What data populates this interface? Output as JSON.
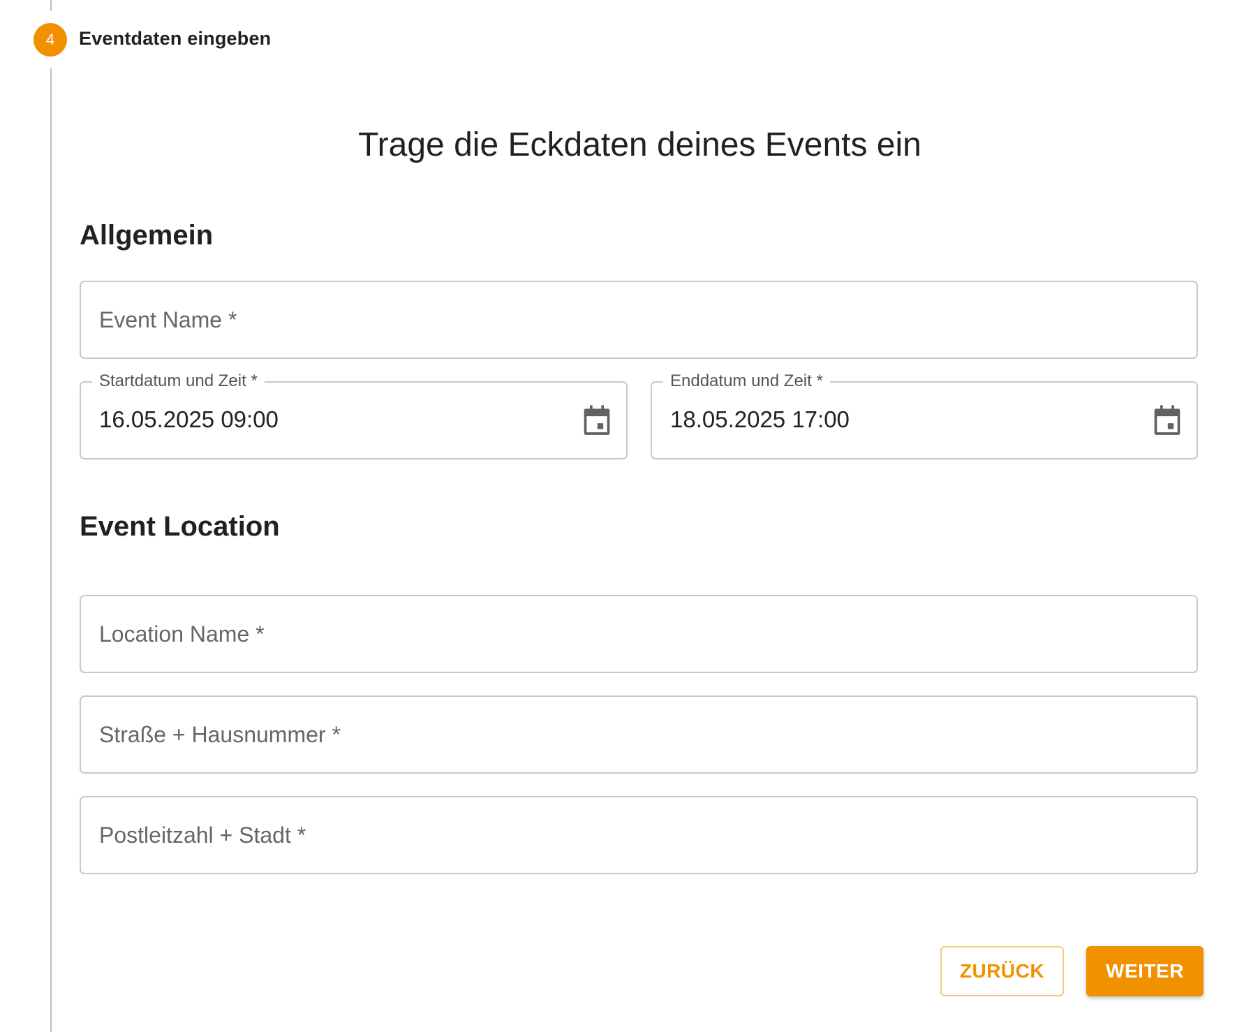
{
  "stepper": {
    "step_number": "4",
    "step_label": "Eventdaten eingeben"
  },
  "page_title": "Trage die Eckdaten deines Events ein",
  "sections": {
    "general": {
      "title": "Allgemein",
      "event_name_placeholder": "Event Name *",
      "start": {
        "label": "Startdatum und Zeit *",
        "value": "16.05.2025 09:00",
        "icon": "calendar-icon"
      },
      "end": {
        "label": "Enddatum und Zeit *",
        "value": "18.05.2025 17:00",
        "icon": "calendar-icon"
      }
    },
    "location": {
      "title": "Event Location",
      "location_name_placeholder": "Location Name *",
      "street_placeholder": "Straße + Hausnummer *",
      "city_placeholder": "Postleitzahl + Stadt *"
    }
  },
  "buttons": {
    "back_label": "ZURÜCK",
    "next_label": "WEITER"
  },
  "colors": {
    "accent": "#f29100",
    "border": "#c8c8c8",
    "text": "#212121",
    "muted_text": "#666666"
  }
}
